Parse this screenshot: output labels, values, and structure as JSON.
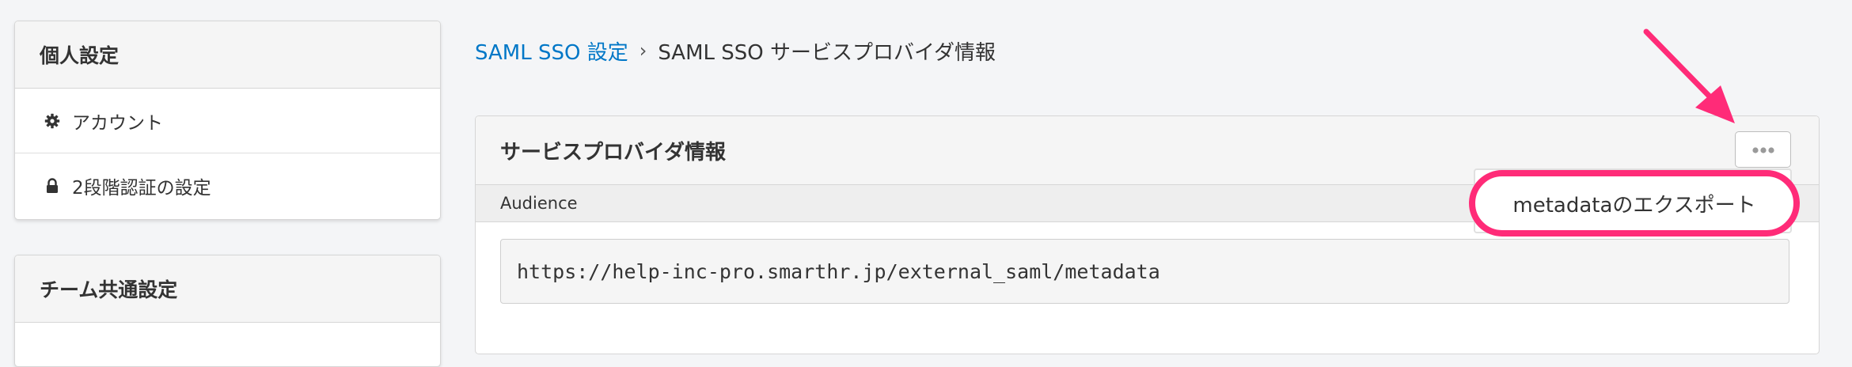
{
  "sidebar": {
    "personal": {
      "title": "個人設定",
      "items": [
        {
          "label": "アカウント",
          "icon": "gear-icon"
        },
        {
          "label": "2段階認証の設定",
          "icon": "lock-icon"
        }
      ]
    },
    "team": {
      "title": "チーム共通設定"
    }
  },
  "breadcrumb": {
    "parent": "SAML SSO 設定",
    "separator": "›",
    "current": "SAML SSO サービスプロバイダ情報"
  },
  "card": {
    "title": "サービスプロバイダ情報",
    "field_label": "Audience",
    "field_value": "https://help-inc-pro.smarthr.jp/external_saml/metadata",
    "more_icon": "ellipsis-icon"
  },
  "dropdown": {
    "items": [
      {
        "label": "metadataのエクスポート"
      }
    ]
  },
  "annotation": {
    "color": "#ff2b78",
    "arrow_icon": "arrow-icon"
  },
  "colors": {
    "link": "#0077c7",
    "background": "#f4f5f7"
  }
}
